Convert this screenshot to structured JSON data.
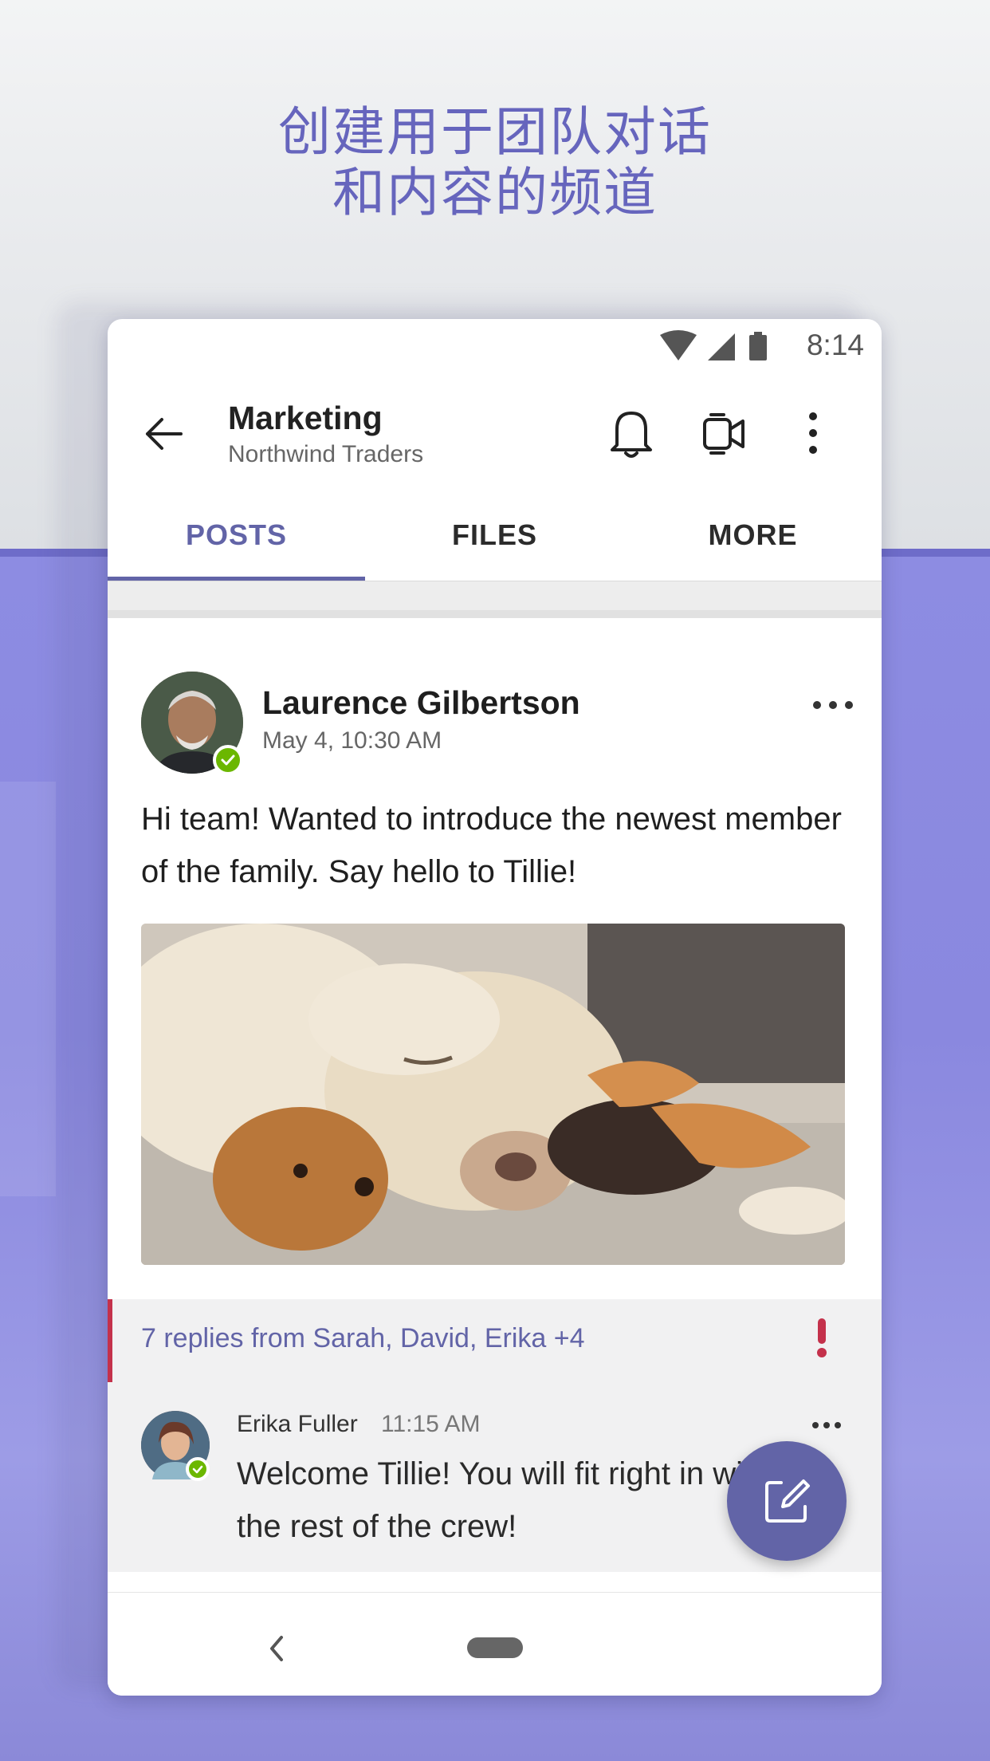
{
  "promo": {
    "line1": "创建用于团队对话",
    "line2": "和内容的频道"
  },
  "status_bar": {
    "time": "8:14"
  },
  "header": {
    "title": "Marketing",
    "subtitle": "Northwind Traders"
  },
  "tabs": [
    {
      "label": "POSTS",
      "active": true
    },
    {
      "label": "FILES",
      "active": false
    },
    {
      "label": "MORE",
      "active": false
    }
  ],
  "post": {
    "author": "Laurence Gilbertson",
    "timestamp": "May 4, 10:30 AM",
    "text": "Hi team! Wanted to introduce the newest member of the family. Say hello to Tillie!"
  },
  "replies": {
    "summary": "7 replies from Sarah, David, Erika +4",
    "latest": {
      "author": "Erika Fuller",
      "time": "11:15 AM",
      "text": "Welcome Tillie! You will fit right in with the rest of the crew!"
    }
  },
  "colors": {
    "accent": "#6264a7",
    "presence": "#6bb700",
    "important": "#c4314b"
  }
}
